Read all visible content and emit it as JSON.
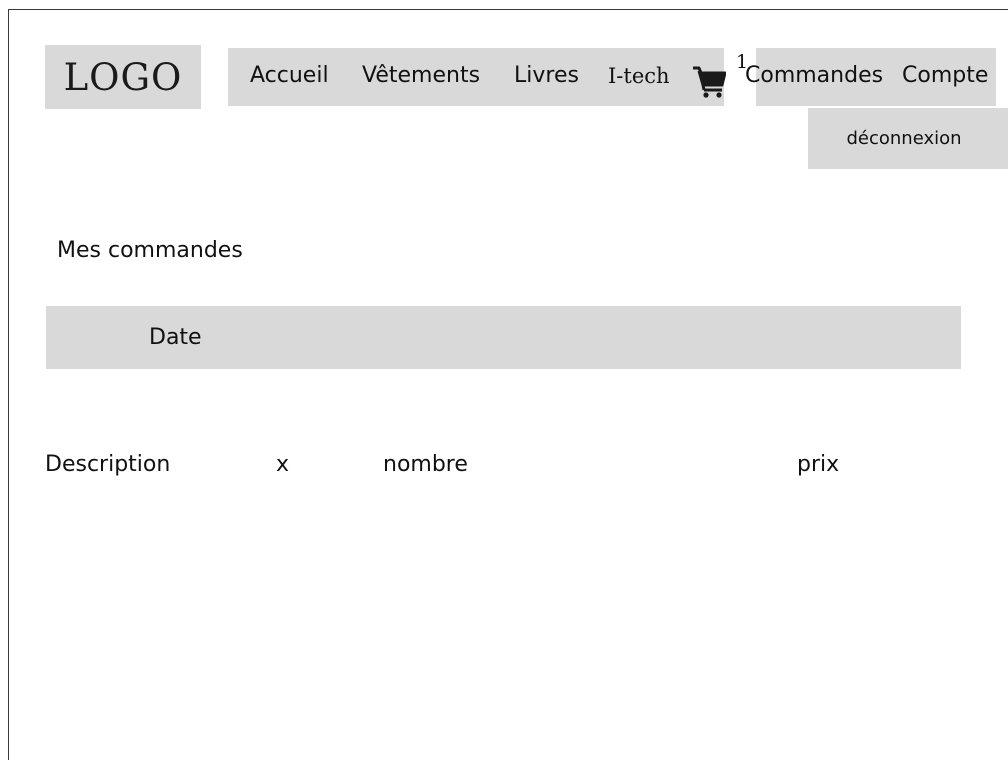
{
  "header": {
    "logo_text": "LOGO",
    "nav": {
      "accueil": "Accueil",
      "vetements": "Vêtements",
      "livres": "Livres",
      "itech": "I-tech",
      "commandes": "Commandes",
      "compte": "Compte"
    },
    "cart": {
      "icon": "cart-icon",
      "count": "1"
    },
    "logout_label": "déconnexion"
  },
  "main": {
    "title": "Mes commandes",
    "order": {
      "date_label": "Date",
      "columns": {
        "description": "Description",
        "x": "x",
        "nombre": "nombre",
        "prix": "prix"
      }
    }
  },
  "colors": {
    "panel": "#d9d9d9",
    "text": "#111111",
    "background": "#ffffff"
  }
}
